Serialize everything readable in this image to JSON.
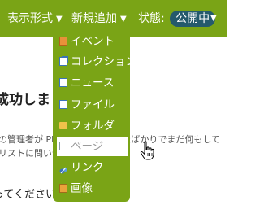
{
  "toolbar": {
    "view_label": "表示形式",
    "add_label": "新規追加",
    "status_label": "状態:",
    "status_value": "公開中",
    "arrow": "▼"
  },
  "add_menu": {
    "items": [
      {
        "label": "イベント",
        "icon": "event-icon"
      },
      {
        "label": "コレクション",
        "icon": "collection-icon"
      },
      {
        "label": "ニュース",
        "icon": "news-icon"
      },
      {
        "label": "ファイル",
        "icon": "file-icon"
      },
      {
        "label": "フォルダ",
        "icon": "folder-icon"
      },
      {
        "label": "ページ",
        "icon": "page-icon",
        "highlighted": true
      },
      {
        "label": "リンク",
        "icon": "link-icon"
      },
      {
        "label": "画像",
        "icon": "image-icon"
      }
    ]
  },
  "background": {
    "heading": "成功しました",
    "body_line_1": "の管理者が Pl",
    "body_line_1_tail": "たばかりでまだ何もして",
    "body_line_2": "リストに問い合",
    "body_line_3": "ってください。"
  },
  "colors": {
    "toolbar_bg": "#7aa416",
    "status_pill_bg": "#245a6c",
    "menu_highlight_bg": "#ffffff"
  }
}
